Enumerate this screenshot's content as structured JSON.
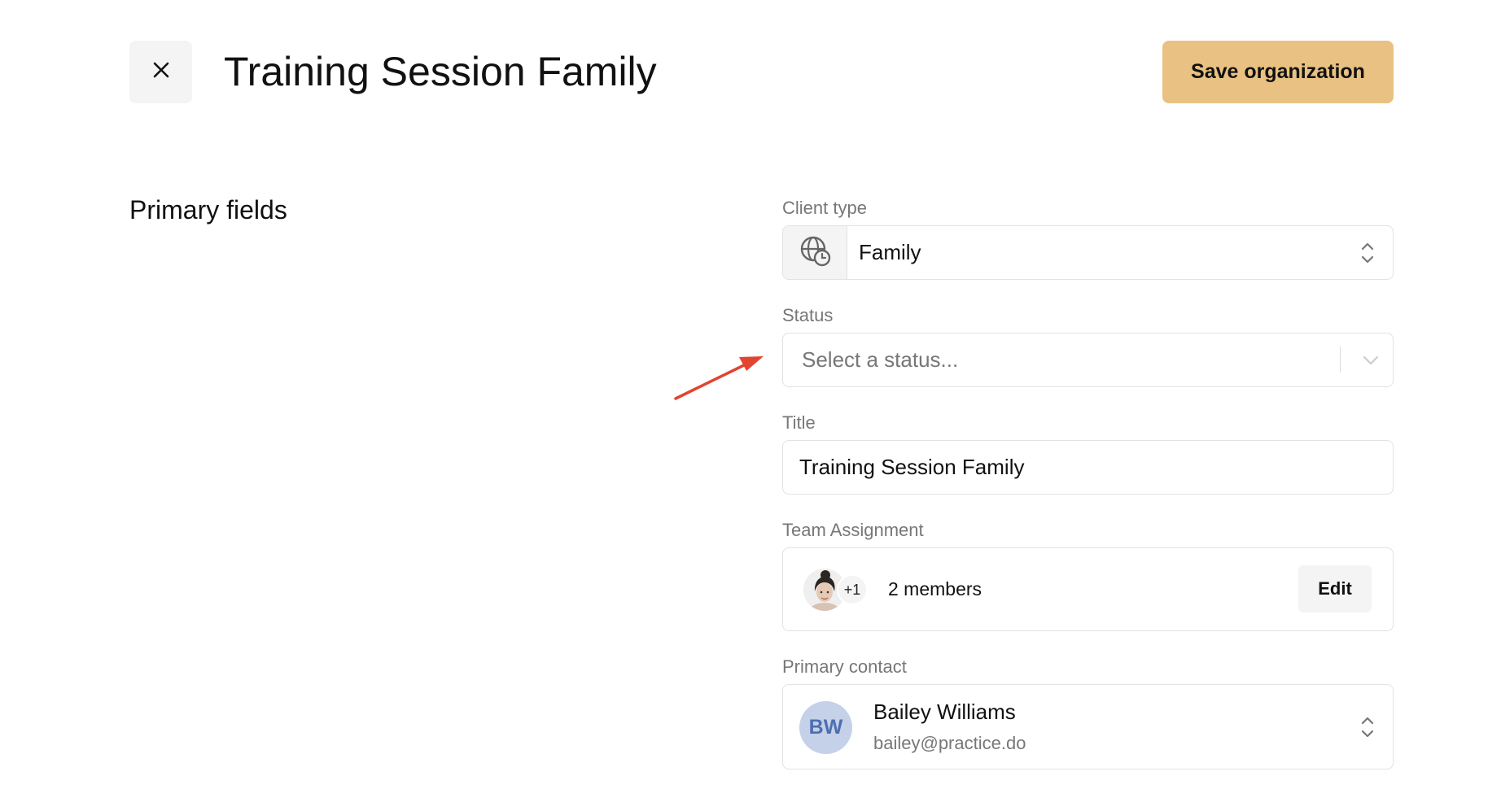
{
  "header": {
    "close_icon": "close-icon",
    "title": "Training Session Family",
    "save_label": "Save organization"
  },
  "section": {
    "heading": "Primary fields"
  },
  "fields": {
    "client_type": {
      "label": "Client type",
      "icon": "globe-clock-icon",
      "value": "Family"
    },
    "status": {
      "label": "Status",
      "placeholder": "Select a status..."
    },
    "title": {
      "label": "Title",
      "value": "Training Session Family"
    },
    "team_assignment": {
      "label": "Team Assignment",
      "extra_count": "+1",
      "members_text": "2 members",
      "edit_label": "Edit"
    },
    "primary_contact": {
      "label": "Primary contact",
      "initials": "BW",
      "name": "Bailey Williams",
      "email": "bailey@practice.do"
    }
  },
  "colors": {
    "save_button_bg": "#e9c283",
    "annotation_arrow": "#e2442f",
    "avatar_initials_bg": "#c5d1e9",
    "avatar_initials_fg": "#4d6fb1"
  }
}
